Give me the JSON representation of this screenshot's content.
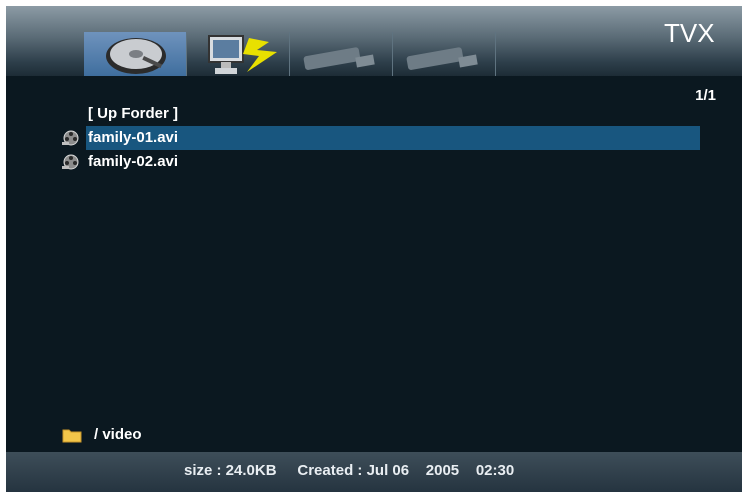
{
  "header": {
    "logo_text": "TVX",
    "tabs": [
      {
        "icon": "hard-drive-icon",
        "active": true
      },
      {
        "icon": "network-pc-icon",
        "active": false
      },
      {
        "icon": "usb-plug-icon",
        "active": false
      },
      {
        "icon": "usb-plug-icon",
        "active": false
      }
    ]
  },
  "main": {
    "page_indicator": "1/1",
    "items": [
      {
        "label": "[ Up Forder ]",
        "icon": null
      },
      {
        "label": "family-01.avi",
        "icon": "film-reel-icon",
        "selected": true
      },
      {
        "label": "family-02.avi",
        "icon": "film-reel-icon",
        "selected": false
      }
    ],
    "current_path": "/ video"
  },
  "status_bar": {
    "size_label": "size : 24.0KB",
    "created_label": "Created : Jul 06",
    "year": "2005",
    "time": "02:30"
  },
  "colors": {
    "background": "#0b1820",
    "selection": "#18567f",
    "accent_yellow": "#e8e000"
  }
}
